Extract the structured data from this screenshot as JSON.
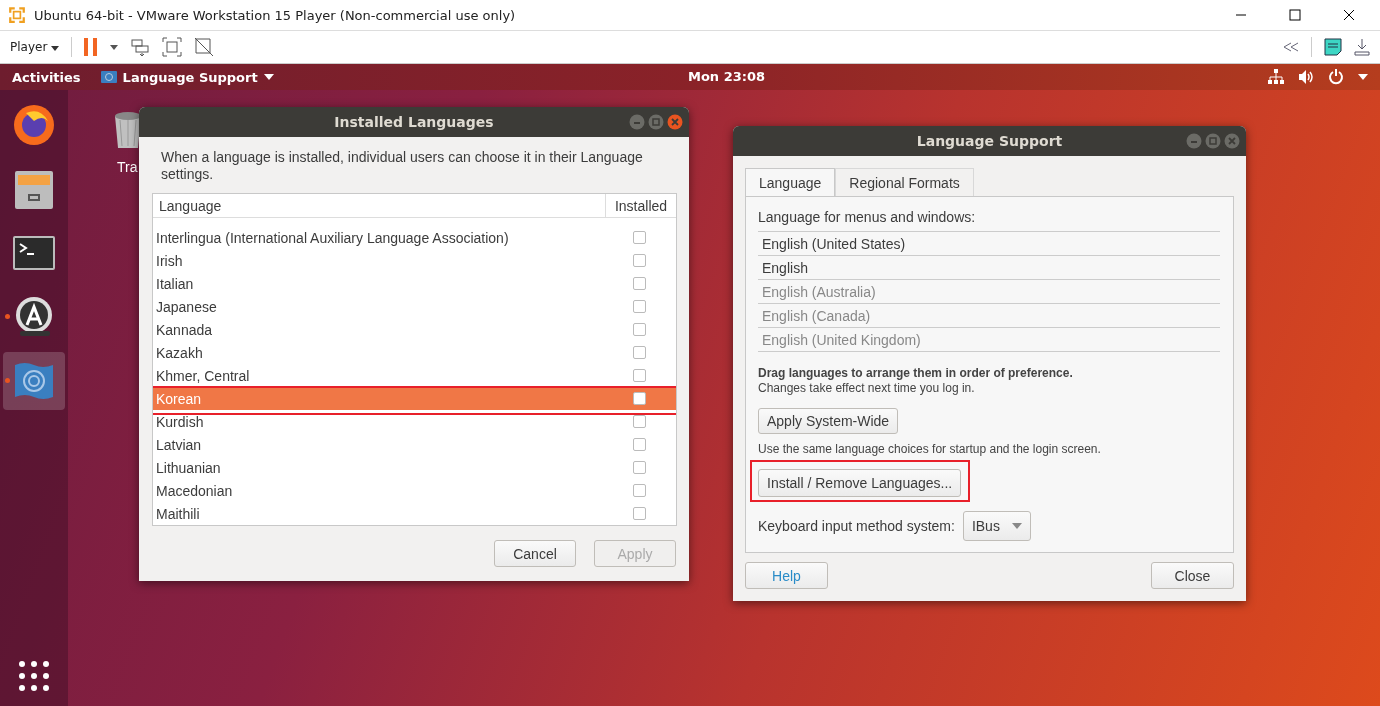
{
  "vm_window": {
    "title": "Ubuntu 64-bit - VMware Workstation 15 Player (Non-commercial use only)",
    "player_menu": "Player"
  },
  "top_bar": {
    "activities": "Activities",
    "app_menu": "Language Support",
    "clock": "Mon 23:08"
  },
  "dock": [
    {
      "kind": "browser",
      "running": false,
      "selected": false
    },
    {
      "kind": "files",
      "running": false,
      "selected": false
    },
    {
      "kind": "terminal",
      "running": false,
      "selected": false
    },
    {
      "kind": "updater",
      "running": true,
      "selected": false
    },
    {
      "kind": "language",
      "running": true,
      "selected": true
    }
  ],
  "desktop": {
    "trash_label": "Tra"
  },
  "installed_dialog": {
    "title": "Installed Languages",
    "description": "When a language is installed, individual users can choose it in their Language settings.",
    "columns": [
      "Language",
      "Installed"
    ],
    "rows": [
      {
        "name": "Interlingua (International Auxiliary Language Association)",
        "installed": false,
        "selected": false
      },
      {
        "name": "Irish",
        "installed": false,
        "selected": false
      },
      {
        "name": "Italian",
        "installed": false,
        "selected": false
      },
      {
        "name": "Japanese",
        "installed": false,
        "selected": false
      },
      {
        "name": "Kannada",
        "installed": false,
        "selected": false
      },
      {
        "name": "Kazakh",
        "installed": false,
        "selected": false
      },
      {
        "name": "Khmer, Central",
        "installed": false,
        "selected": false
      },
      {
        "name": "Korean",
        "installed": false,
        "selected": true
      },
      {
        "name": "Kurdish",
        "installed": false,
        "selected": false
      },
      {
        "name": "Latvian",
        "installed": false,
        "selected": false
      },
      {
        "name": "Lithuanian",
        "installed": false,
        "selected": false
      },
      {
        "name": "Macedonian",
        "installed": false,
        "selected": false
      },
      {
        "name": "Maithili",
        "installed": false,
        "selected": false
      }
    ],
    "buttons": [
      {
        "label": "Cancel",
        "disabled": false
      },
      {
        "label": "Apply",
        "disabled": true
      }
    ]
  },
  "language_support": {
    "title": "Language Support",
    "tabs": [
      {
        "label": "Language",
        "selected": true
      },
      {
        "label": "Regional Formats",
        "selected": false
      }
    ],
    "menus_label": "Language for menus and windows:",
    "languages": [
      {
        "name": "English (United States)",
        "dimmed": false
      },
      {
        "name": "English",
        "dimmed": false
      },
      {
        "name": "English (Australia)",
        "dimmed": true
      },
      {
        "name": "English (Canada)",
        "dimmed": true
      },
      {
        "name": "English (United Kingdom)",
        "dimmed": true
      }
    ],
    "drag_note": "Drag languages to arrange them in order of preference.",
    "changes_note": "Changes take effect next time you log in.",
    "apply_button": "Apply System-Wide",
    "same_note": "Use the same language choices for startup and the login screen.",
    "install_button": {
      "label": "Install / Remove Languages...",
      "highlighted": true
    },
    "keyboard_label": "Keyboard input method system:",
    "keyboard_value": "IBus",
    "help_button": "Help",
    "close_button": "Close"
  }
}
